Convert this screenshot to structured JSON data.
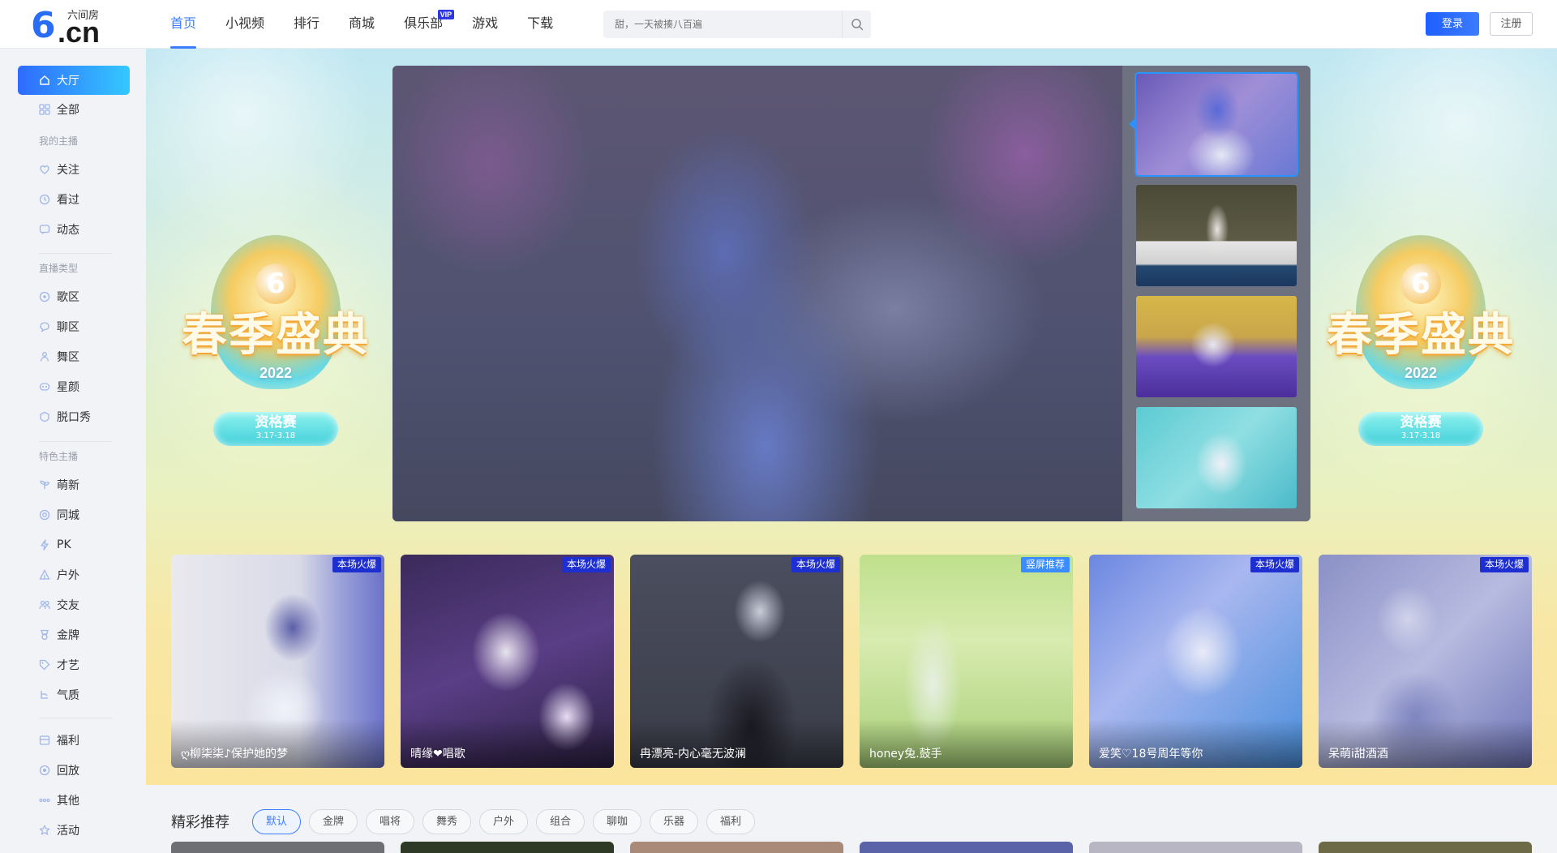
{
  "header": {
    "logo_name": "六间房",
    "logo_mark": "6",
    "logo_domain": ".cn",
    "nav": [
      {
        "label": "首页",
        "active": true
      },
      {
        "label": "小视频"
      },
      {
        "label": "排行"
      },
      {
        "label": "商城"
      },
      {
        "label": "俱乐部",
        "badge": "VIP"
      },
      {
        "label": "游戏"
      },
      {
        "label": "下载"
      }
    ],
    "search_placeholder": "甜，一天被揍八百遍",
    "login": "登录",
    "register": "注册"
  },
  "sidebar": {
    "top": [
      {
        "label": "大厅",
        "icon": "home-icon",
        "active": true
      },
      {
        "label": "全部",
        "icon": "grid-icon"
      }
    ],
    "group1_title": "我的主播",
    "group1": [
      {
        "label": "关注",
        "icon": "heart-icon"
      },
      {
        "label": "看过",
        "icon": "clock-icon"
      },
      {
        "label": "动态",
        "icon": "message-icon"
      }
    ],
    "group2_title": "直播类型",
    "group2": [
      {
        "label": "歌区",
        "icon": "music-icon"
      },
      {
        "label": "聊区",
        "icon": "chat-icon"
      },
      {
        "label": "舞区",
        "icon": "dance-icon"
      },
      {
        "label": "星颜",
        "icon": "star-face-icon"
      },
      {
        "label": "脱口秀",
        "icon": "talkshow-icon"
      }
    ],
    "group3_title": "特色主播",
    "group3": [
      {
        "label": "萌新",
        "icon": "sprout-icon"
      },
      {
        "label": "同城",
        "icon": "location-icon"
      },
      {
        "label": "PK",
        "icon": "lightning-icon"
      },
      {
        "label": "户外",
        "icon": "outdoor-icon"
      },
      {
        "label": "交友",
        "icon": "friends-icon"
      },
      {
        "label": "金牌",
        "icon": "medal-icon"
      },
      {
        "label": "才艺",
        "icon": "tag-icon"
      },
      {
        "label": "气质",
        "icon": "temperament-icon"
      }
    ],
    "bottom": [
      {
        "label": "福利",
        "icon": "gift-icon"
      },
      {
        "label": "回放",
        "icon": "replay-icon"
      },
      {
        "label": "其他",
        "icon": "more-icon"
      },
      {
        "label": "活动",
        "icon": "star-icon"
      }
    ]
  },
  "banner": {
    "event_title": "春季盛典",
    "event_year": "2022",
    "event_stage": "资格赛",
    "event_dates": "3.17-3.18",
    "colors": {
      "accent": "#3d7dff",
      "badge": "#1e2fd2",
      "banner_bottom": "#fbe49c"
    }
  },
  "cards": [
    {
      "badge": "本场火爆",
      "caption": "ღ柳柒柒♪保护她的梦"
    },
    {
      "badge": "本场火爆",
      "caption": "晴缘❤唱歌"
    },
    {
      "badge": "本场火爆",
      "caption": "冉漂亮-内心毫无波澜"
    },
    {
      "badge": "竖屏推荐",
      "caption": "honey兔.鼓手"
    },
    {
      "badge": "本场火爆",
      "caption": "爱笑♡18号周年等你"
    },
    {
      "badge": "本场火爆",
      "caption": "呆萌i甜酒酒"
    }
  ],
  "recommend": {
    "title": "精彩推荐",
    "chips": [
      "默认",
      "金牌",
      "唱将",
      "舞秀",
      "户外",
      "组合",
      "聊咖",
      "乐器",
      "福利"
    ]
  }
}
